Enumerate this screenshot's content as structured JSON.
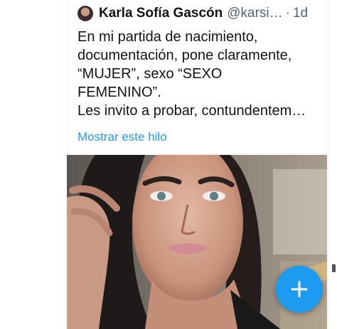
{
  "tweet": {
    "display_name": "Karla Sofía Gascón",
    "handle": "@karsi…",
    "separator": "·",
    "time": "1d",
    "text": "En mi partida de nacimiento,\ndocumentación, pone claramente,\n“MUJER”, sexo “SEXO\nFEMENINO”.\nLes invito a probar, contundentem…",
    "show_thread_label": "Mostrar este hilo"
  },
  "fab": {
    "icon": "plus-icon",
    "color": "#1d9bf0"
  },
  "colors": {
    "text_primary": "#0f1419",
    "text_secondary": "#536471",
    "link": "#1d9bf0"
  }
}
